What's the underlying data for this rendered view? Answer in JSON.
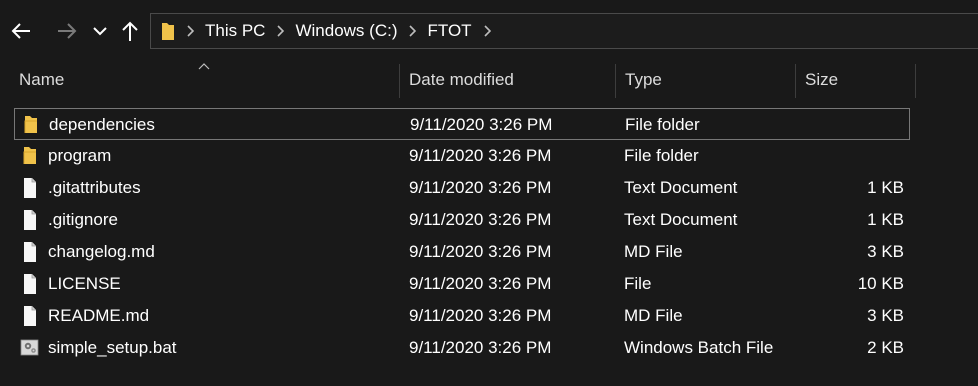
{
  "breadcrumb": [
    "This PC",
    "Windows (C:)",
    "FTOT"
  ],
  "columns": {
    "name": "Name",
    "date": "Date modified",
    "type": "Type",
    "size": "Size"
  },
  "files": [
    {
      "name": "dependencies",
      "date": "9/11/2020 3:26 PM",
      "type": "File folder",
      "size": "",
      "icon": "folder-icon"
    },
    {
      "name": "program",
      "date": "9/11/2020 3:26 PM",
      "type": "File folder",
      "size": "",
      "icon": "folder-icon"
    },
    {
      "name": ".gitattributes",
      "date": "9/11/2020 3:26 PM",
      "type": "Text Document",
      "size": "1 KB",
      "icon": "document-icon"
    },
    {
      "name": ".gitignore",
      "date": "9/11/2020 3:26 PM",
      "type": "Text Document",
      "size": "1 KB",
      "icon": "document-icon"
    },
    {
      "name": "changelog.md",
      "date": "9/11/2020 3:26 PM",
      "type": "MD File",
      "size": "3 KB",
      "icon": "document-icon"
    },
    {
      "name": "LICENSE",
      "date": "9/11/2020 3:26 PM",
      "type": "File",
      "size": "10 KB",
      "icon": "document-icon"
    },
    {
      "name": "README.md",
      "date": "9/11/2020 3:26 PM",
      "type": "MD File",
      "size": "3 KB",
      "icon": "document-icon"
    },
    {
      "name": "simple_setup.bat",
      "date": "9/11/2020 3:26 PM",
      "type": "Windows Batch File",
      "size": "2 KB",
      "icon": "batch-file-icon"
    }
  ],
  "colors": {
    "background": "#191919",
    "text": "#ffffff",
    "folder": "#f0c24a",
    "selection_border": "#777777"
  }
}
